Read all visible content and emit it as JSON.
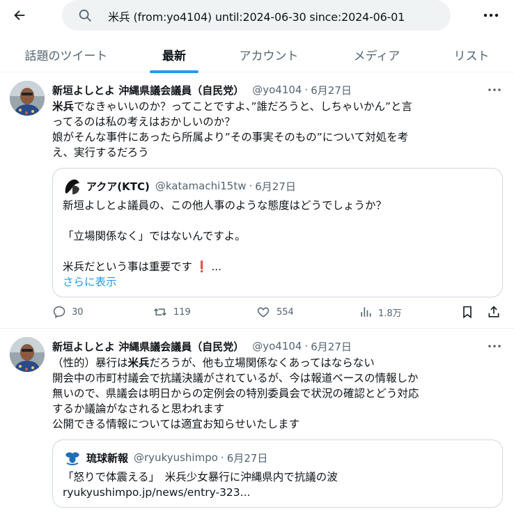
{
  "search": {
    "query": "米兵 (from:yo4104) until:2024-06-30 since:2024-06-01"
  },
  "icons": {
    "back": "arrow-left-icon",
    "search": "search-icon",
    "more": "more-horizontal-icon",
    "reply": "reply-icon",
    "retweet": "retweet-icon",
    "like": "heart-icon",
    "views": "views-icon",
    "bookmark": "bookmark-icon",
    "share": "share-icon"
  },
  "colors": {
    "accent": "#1d9bf0",
    "secondary_text": "#536471",
    "alert": "#e0245e"
  },
  "tabs": [
    {
      "label": "話題のツイート"
    },
    {
      "label": "最新"
    },
    {
      "label": "アカウント"
    },
    {
      "label": "メディア"
    },
    {
      "label": "リスト"
    }
  ],
  "active_tab": "最新",
  "tweets": [
    {
      "name": "新垣よしとよ 沖縄県議会議員（自民党）",
      "handle": "@yo4104",
      "separator": "·",
      "date": "6月27日",
      "body": {
        "l1_hl": "米兵",
        "l1_rest": "でなきゃいいのか？ってことですよ、”誰だろうと、しちゃいかん”と言",
        "l2": "ってるのは私の考えはおかしいのか？",
        "l3": "娘がそんな事件にあったら所属より”その事実そのもの”について対処を考",
        "l4": "え、実行するだろう"
      },
      "quote": {
        "name": "アクア(KTC)",
        "handle": "@katamachi15tw",
        "separator": "·",
        "date": "6月27日",
        "l1": "新垣よしとよ議員の、この他人事のような態度はどうでしょうか？",
        "l2": "「立場関係なく」ではないんですよ。",
        "l3": "米兵だという事は重要です",
        "l3_suffix": "...",
        "more_link": "さらに表示"
      },
      "stats": {
        "replies": "30",
        "retweets": "119",
        "likes": "554",
        "views": "1.8万"
      }
    },
    {
      "name": "新垣よしとよ 沖縄県議会議員（自民党）",
      "handle": "@yo4104",
      "separator": "·",
      "date": "6月27日",
      "body": {
        "l1_pre": "（性的）暴行は",
        "l1_hl": "米兵",
        "l1_rest": "だろうが、他も立場関係なくあってはならない",
        "l2": "開会中の市町村議会で抗議決議がされているが、今は報道ベースの情報しか",
        "l3": "無いので、県議会は明日からの定例会の特別委員会で状況の確認とどう対応",
        "l4": "するか議論がなされると思われます",
        "l5": "公開できる情報については適宜お知らせいたします"
      },
      "quote": {
        "name": "琉球新報",
        "handle": "@ryukyushimpo",
        "separator": "·",
        "date": "6月27日",
        "l1": "「怒りで体震える」　米兵少女暴行に沖縄県内で抗議の波",
        "l2": "ryukyushimpo.jp/news/entry-323..."
      }
    }
  ]
}
